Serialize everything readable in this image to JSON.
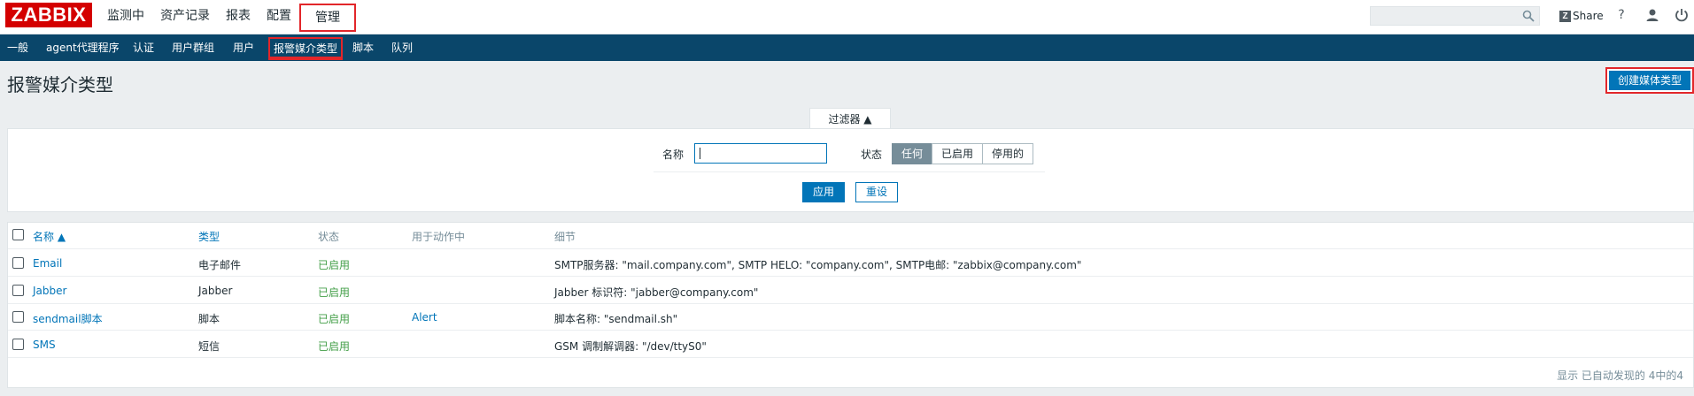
{
  "header": {
    "logo": "ZABBIX",
    "menu": [
      {
        "label": "监测中"
      },
      {
        "label": "资产记录"
      },
      {
        "label": "报表"
      },
      {
        "label": "配置"
      },
      {
        "label": "管理"
      }
    ],
    "share_label": "Share",
    "help_glyph": "?",
    "search": {
      "value": "",
      "placeholder": ""
    }
  },
  "subnav": {
    "items": [
      {
        "label": "一般"
      },
      {
        "label": "agent代理程序"
      },
      {
        "label": "认证"
      },
      {
        "label": "用户群组"
      },
      {
        "label": "用户"
      },
      {
        "label": "报警媒介类型"
      },
      {
        "label": "脚本"
      },
      {
        "label": "队列"
      }
    ]
  },
  "page": {
    "title": "报警媒介类型",
    "create_button": "创建媒体类型"
  },
  "filter": {
    "tab_label": "过滤器 ▲",
    "name_label": "名称",
    "name_value": "",
    "status_label": "状态",
    "status_options": [
      "任何",
      "已启用",
      "停用的"
    ],
    "status_selected": "任何",
    "apply": "应用",
    "reset": "重设"
  },
  "table": {
    "columns": [
      "名称 ▲",
      "类型",
      "状态",
      "用于动作中",
      "细节"
    ],
    "rows": [
      {
        "name": "Email",
        "type": "电子邮件",
        "status": "已启用",
        "used_in": "",
        "details": "SMTP服务器: \"mail.company.com\", SMTP HELO: \"company.com\", SMTP电邮: \"zabbix@company.com\""
      },
      {
        "name": "Jabber",
        "type": "Jabber",
        "status": "已启用",
        "used_in": "",
        "details": "Jabber 标识符: \"jabber@company.com\""
      },
      {
        "name": "sendmail脚本",
        "type": "脚本",
        "status": "已启用",
        "used_in": "Alert",
        "details": "脚本名称: \"sendmail.sh\""
      },
      {
        "name": "SMS",
        "type": "短信",
        "status": "已启用",
        "used_in": "",
        "details": "GSM 调制解调器: \"/dev/ttyS0\""
      }
    ],
    "footer": "显示 已自动发现的 4中的4"
  },
  "colors": {
    "logo_red": "#d40000",
    "subnav_bg": "#0a466a",
    "primary": "#0275b8",
    "enabled_green": "#429e47",
    "highlight_red": "#e2262a"
  }
}
